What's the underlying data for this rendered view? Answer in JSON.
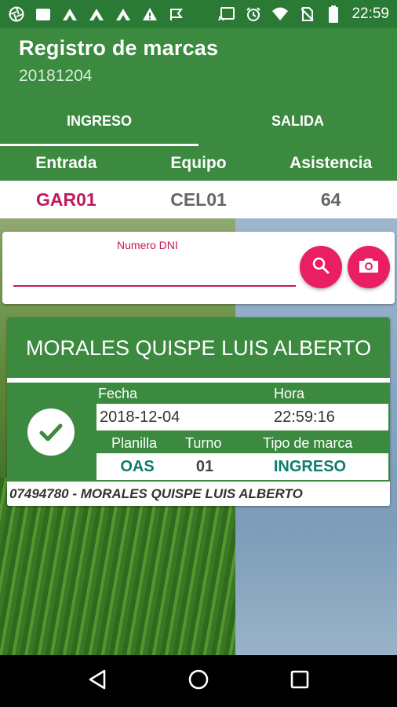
{
  "status_bar": {
    "time": "22:59",
    "left_icons": [
      "aperture-icon",
      "square-icon",
      "app-a-icon",
      "app-a-icon",
      "app-a-icon",
      "warning-icon",
      "check-flag-icon"
    ],
    "right_icons": [
      "cast-icon",
      "alarm-icon",
      "wifi-icon",
      "no-sim-icon",
      "battery-icon"
    ]
  },
  "app": {
    "title": "Registro de marcas",
    "subtitle": "20181204",
    "tabs": [
      {
        "label": "INGRESO",
        "active": true
      },
      {
        "label": "SALIDA",
        "active": false
      }
    ]
  },
  "info": {
    "headers": [
      "Entrada",
      "Equipo",
      "Asistencia"
    ],
    "values": [
      "GAR01",
      "CEL01",
      "64"
    ]
  },
  "search": {
    "label": "Numero DNI",
    "value": "",
    "search_icon": "search-icon",
    "camera_icon": "camera-icon"
  },
  "result": {
    "name": "MORALES QUISPE  LUIS ALBERTO",
    "fecha_label": "Fecha",
    "fecha_value": "2018-12-04",
    "hora_label": "Hora",
    "hora_value": "22:59:16",
    "planilla_label": "Planilla",
    "turno_label": "Turno",
    "tipo_label": "Tipo de marca",
    "planilla_value": "OAS",
    "turno_value": "01",
    "tipo_value": "INGRESO",
    "footer": "07494780 - MORALES QUISPE  LUIS ALBERTO",
    "status_icon": "check-icon"
  },
  "nav": {
    "icons": [
      "back-icon",
      "home-icon",
      "recents-icon"
    ]
  },
  "colors": {
    "primary": "#3b8a3f",
    "status_bar": "#2a7a35",
    "accent": "#e91e63",
    "entrada_value": "#c2185b",
    "teal_value": "#0f7b6f"
  }
}
